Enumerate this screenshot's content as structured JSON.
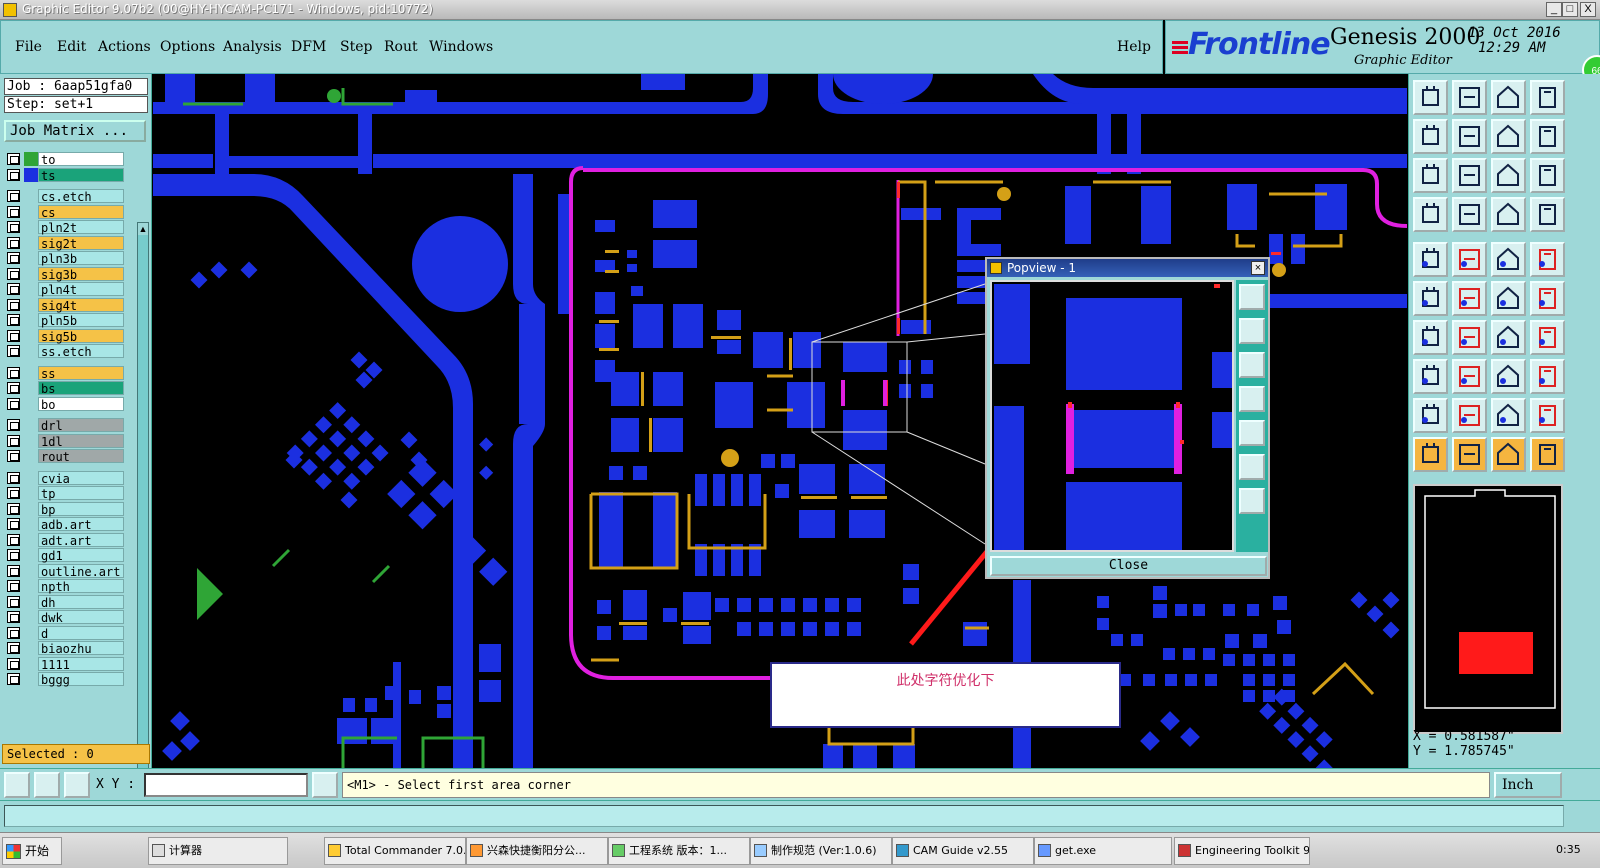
{
  "window": {
    "title": "Graphic Editor 9.07b2 (00@HY-HYCAM-PC171 - Windows, pid:10772)",
    "min_label": "_",
    "max_label": "□",
    "close_label": "X"
  },
  "menu": {
    "items": [
      "File",
      "Edit",
      "Actions",
      "Options",
      "Analysis",
      "DFM",
      "Step",
      "Rout",
      "Windows"
    ],
    "help": "Help"
  },
  "brand": {
    "logo_text": "Frontline",
    "product": "Genesis 2000",
    "subtitle": "Graphic Editor",
    "date": "13 Oct 2016",
    "time": "12:29 AM",
    "badge": "66"
  },
  "job": {
    "job_line": "Job : 6aap51gfa0",
    "step_line": "Step: set+1",
    "matrix_button": "Job Matrix ..."
  },
  "layers": [
    {
      "name": "to",
      "swatch": "#2fa536",
      "bg": "#ffffff"
    },
    {
      "name": "ts",
      "swatch": "#1b2fe0",
      "bg": "#1aa37a"
    },
    {
      "name": "cs.etch",
      "swatch": "",
      "bg": "#a8e6e6"
    },
    {
      "name": "cs",
      "swatch": "",
      "bg": "#f5c247"
    },
    {
      "name": "pln2t",
      "swatch": "",
      "bg": "#a8e6e6"
    },
    {
      "name": "sig2t",
      "swatch": "",
      "bg": "#f5c247"
    },
    {
      "name": "pln3b",
      "swatch": "",
      "bg": "#a8e6e6"
    },
    {
      "name": "sig3b",
      "swatch": "",
      "bg": "#f5c247"
    },
    {
      "name": "pln4t",
      "swatch": "",
      "bg": "#a8e6e6"
    },
    {
      "name": "sig4t",
      "swatch": "",
      "bg": "#f5c247"
    },
    {
      "name": "pln5b",
      "swatch": "",
      "bg": "#a8e6e6"
    },
    {
      "name": "sig5b",
      "swatch": "",
      "bg": "#f5c247"
    },
    {
      "name": "ss.etch",
      "swatch": "",
      "bg": "#a8e6e6"
    },
    {
      "name": "ss",
      "swatch": "",
      "bg": "#f5c247"
    },
    {
      "name": "bs",
      "swatch": "",
      "bg": "#1aa37a"
    },
    {
      "name": "bo",
      "swatch": "",
      "bg": "#ffffff"
    },
    {
      "name": "drl",
      "swatch": "",
      "bg": "#a0a8a8"
    },
    {
      "name": "1dl",
      "swatch": "",
      "bg": "#a0a8a8"
    },
    {
      "name": "rout",
      "swatch": "",
      "bg": "#a0a8a8"
    },
    {
      "name": "cvia",
      "swatch": "",
      "bg": "#a8e6e6"
    },
    {
      "name": "tp",
      "swatch": "",
      "bg": "#a8e6e6"
    },
    {
      "name": "bp",
      "swatch": "",
      "bg": "#a8e6e6"
    },
    {
      "name": "adb.art",
      "swatch": "",
      "bg": "#a8e6e6"
    },
    {
      "name": "adt.art",
      "swatch": "",
      "bg": "#a8e6e6"
    },
    {
      "name": "gd1",
      "swatch": "",
      "bg": "#a8e6e6"
    },
    {
      "name": "outline.art",
      "swatch": "",
      "bg": "#a8e6e6"
    },
    {
      "name": "npth",
      "swatch": "",
      "bg": "#a8e6e6"
    },
    {
      "name": "dh",
      "swatch": "",
      "bg": "#a8e6e6"
    },
    {
      "name": "dwk",
      "swatch": "",
      "bg": "#a8e6e6"
    },
    {
      "name": "d",
      "swatch": "",
      "bg": "#a8e6e6"
    },
    {
      "name": "biaozhu",
      "swatch": "",
      "bg": "#a8e6e6"
    },
    {
      "name": "1111",
      "swatch": "",
      "bg": "#a8e6e6"
    },
    {
      "name": "bggg",
      "swatch": "",
      "bg": "#a8e6e6"
    }
  ],
  "selected": "Selected : 0",
  "popview": {
    "title": "Popview - 1",
    "close_button": "Close"
  },
  "annotation": "此处字符优化下",
  "coords": {
    "x": "X = 0.581587\"",
    "y": "Y = 1.785745\""
  },
  "command": {
    "xy_label": "X Y :",
    "xy_value": "",
    "prompt": "<M1> - Select first area corner",
    "unit": "Inch"
  },
  "taskbar": {
    "start": "开始",
    "tasks": [
      "计算器",
      "Total Commander 7.0...",
      "兴森快捷衡阳分公...",
      "工程系统  版本：1...",
      "制作规范 (Ver:1.0.6)",
      "CAM Guide v2.55",
      "get.exe",
      "Engineering Toolkit 9..."
    ],
    "clock": "0:35"
  },
  "colors": {
    "panel": "#9ed8d8",
    "copper": "#1b2fe0",
    "outline": "#e020e0",
    "silk": "#d4a017",
    "arrow": "#ff1a1a"
  }
}
